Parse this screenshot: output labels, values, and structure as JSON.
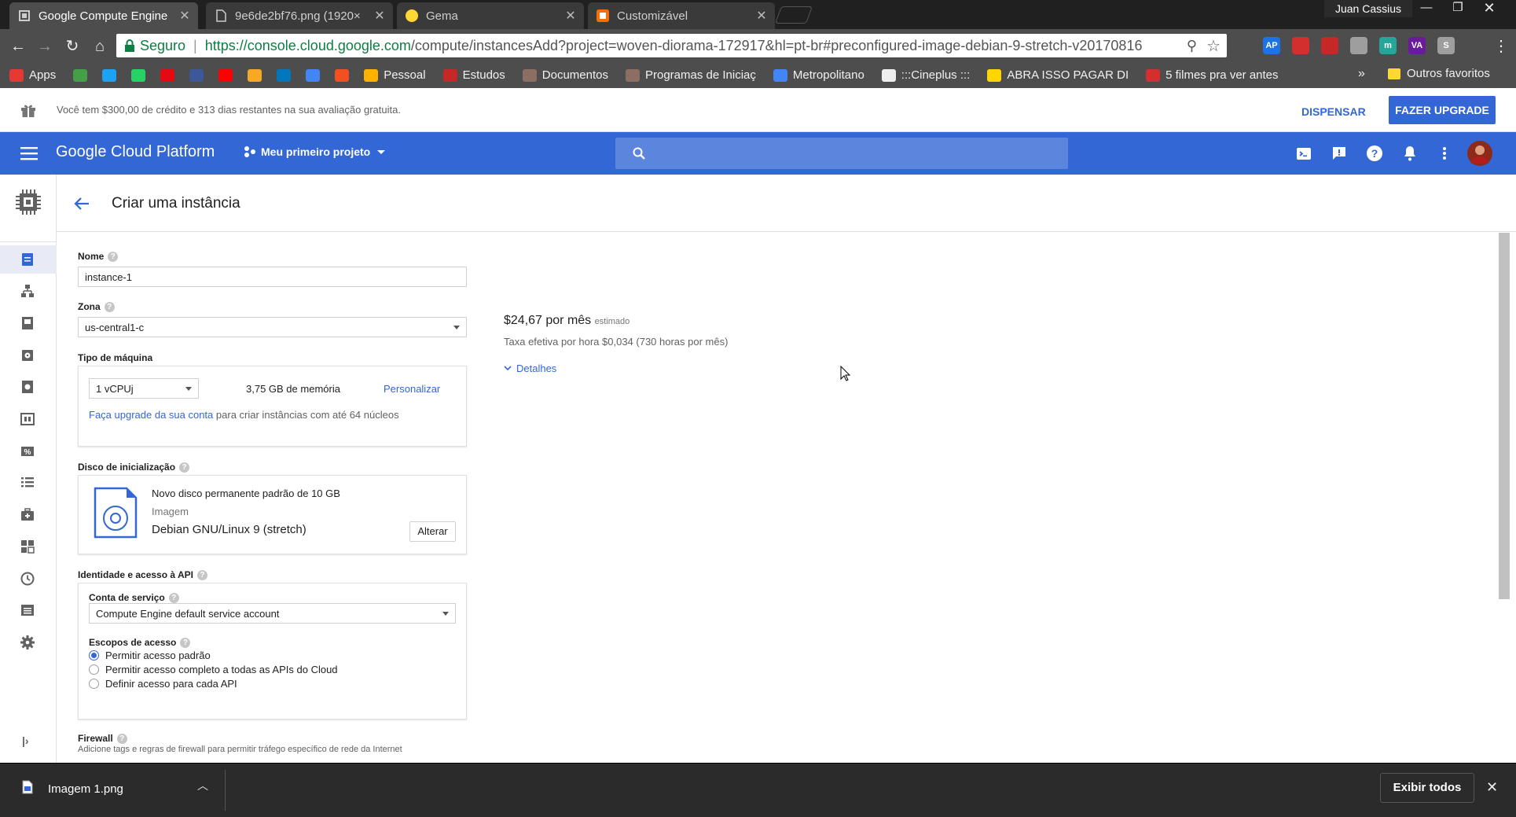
{
  "browser": {
    "tabs": [
      {
        "title": "Google Compute Engine",
        "icon": "gcp-favicon"
      },
      {
        "title": "9e6de2bf76.png (1920×",
        "icon": "page-icon"
      },
      {
        "title": "Gema",
        "icon": "gema-favicon"
      },
      {
        "title": "Customizável",
        "icon": "canva-favicon"
      }
    ],
    "profile_name": "Juan Cassius",
    "secure_label": "Seguro",
    "url_host": "https://console.cloud.google.com",
    "url_rest": "/compute/instancesAdd?project=woven-diorama-172917&hl=pt-br#preconfigured-image-debian-9-stretch-v20170816",
    "extensions": [
      {
        "label": "AP",
        "color": "#1a73e8"
      },
      {
        "label": "",
        "color": "#d32f2f"
      },
      {
        "label": "",
        "color": "#c62828"
      },
      {
        "label": "",
        "color": "#9e9e9e"
      },
      {
        "label": "m",
        "color": "#26a69a"
      },
      {
        "label": "VA",
        "color": "#6a1b9a"
      },
      {
        "label": "S",
        "color": "#9e9e9e"
      }
    ],
    "bookmarks": [
      {
        "label": "Apps",
        "color": "#e53935"
      },
      {
        "label": "",
        "color": "#43a047"
      },
      {
        "label": "",
        "color": "#1da1f2"
      },
      {
        "label": "",
        "color": "#25d366"
      },
      {
        "label": "",
        "color": "#e50914"
      },
      {
        "label": "",
        "color": "#3b5998"
      },
      {
        "label": "",
        "color": "#ff0000"
      },
      {
        "label": "",
        "color": "#f9a825"
      },
      {
        "label": "",
        "color": "#0277bd"
      },
      {
        "label": "",
        "color": "#4285f4"
      },
      {
        "label": "",
        "color": "#f25022"
      },
      {
        "label": "Pessoal",
        "color": "#ffb300"
      },
      {
        "label": "Estudos",
        "color": "#c62828"
      },
      {
        "label": "Documentos",
        "color": "#8d6e63"
      },
      {
        "label": "Programas de Iniciaç",
        "color": "#8d6e63"
      },
      {
        "label": "Metropolitano",
        "color": "#4285f4"
      },
      {
        "label": ":::Cineplus :::",
        "color": "#eeeeee"
      },
      {
        "label": "ABRA ISSO PAGAR DI",
        "color": "#ffd600"
      },
      {
        "label": "5 filmes pra ver antes",
        "color": "#d32f2f"
      }
    ],
    "bookmarks_overflow": "»",
    "other_bookmarks": "Outros favoritos"
  },
  "promo": {
    "text": "Você tem $300,00 de crédito e 313 dias restantes na sua avaliação gratuita.",
    "dismiss": "DISPENSAR",
    "upgrade": "FAZER UPGRADE"
  },
  "appbar": {
    "logo": "Google Cloud Platform",
    "project": "Meu primeiro projeto"
  },
  "page": {
    "title": "Criar uma instância"
  },
  "form": {
    "name_label": "Nome",
    "name_value": "instance-1",
    "zone_label": "Zona",
    "zone_value": "us-central1-c",
    "machine_label": "Tipo de máquina",
    "vcpu_value": "1 vCPUj",
    "memory": "3,75 GB de memória",
    "customize": "Personalizar",
    "upgrade_link": "Faça upgrade da sua conta",
    "upgrade_rest": "para criar instâncias com até 64 núcleos",
    "boot_label": "Disco de inicialização",
    "disk_title": "Novo disco permanente padrão de 10 GB",
    "disk_image_label": "Imagem",
    "disk_image": "Debian GNU/Linux 9 (stretch)",
    "change": "Alterar",
    "identity_label": "Identidade e acesso à API",
    "service_account_label": "Conta de serviço",
    "service_account_value": "Compute Engine default service account",
    "scopes_label": "Escopos de acesso",
    "scopes": [
      {
        "label": "Permitir acesso padrão",
        "selected": true
      },
      {
        "label": "Permitir acesso completo a todas as APIs do Cloud",
        "selected": false
      },
      {
        "label": "Definir acesso para cada API",
        "selected": false
      }
    ],
    "firewall_label": "Firewall",
    "firewall_desc": "Adicione tags e regras de firewall para permitir tráfego específico de rede da Internet"
  },
  "pricing": {
    "price": "$24,67 por mês",
    "estimated": "estimado",
    "hourly": "Taxa efetiva por hora $0,034 (730 horas por mês)",
    "details": "Detalhes"
  },
  "download": {
    "filename": "Imagem 1.png",
    "show_all": "Exibir todos"
  }
}
